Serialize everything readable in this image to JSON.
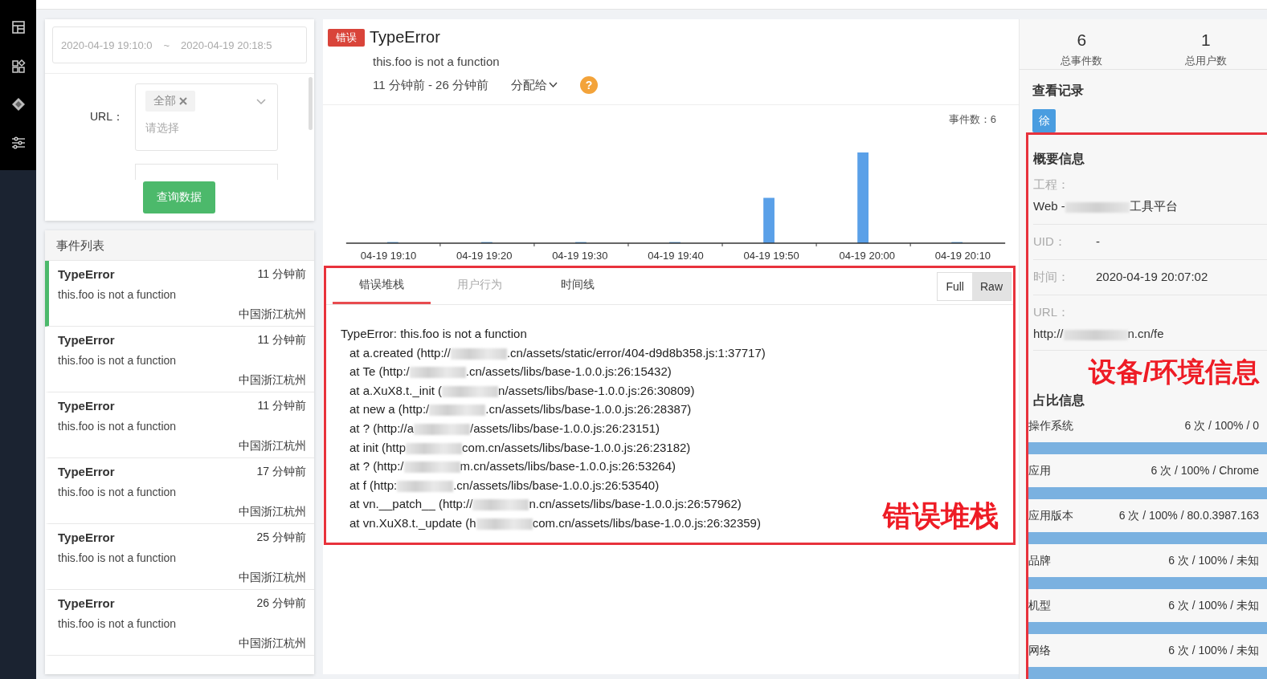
{
  "filter": {
    "date_start": "2020-04-19 19:10:0",
    "date_sep": "~",
    "date_end": "2020-04-19 20:18:5",
    "url_label": "URL：",
    "url_tag": "全部",
    "url_placeholder": "请选择",
    "query_button": "查询数据"
  },
  "event_list": {
    "title": "事件列表",
    "items": [
      {
        "name": "TypeError",
        "message": "this.foo is not a function",
        "time": "11 分钟前",
        "location": "中国浙江杭州",
        "selected": true
      },
      {
        "name": "TypeError",
        "message": "this.foo is not a function",
        "time": "11 分钟前",
        "location": "中国浙江杭州",
        "selected": false
      },
      {
        "name": "TypeError",
        "message": "this.foo is not a function",
        "time": "11 分钟前",
        "location": "中国浙江杭州",
        "selected": false
      },
      {
        "name": "TypeError",
        "message": "this.foo is not a function",
        "time": "17 分钟前",
        "location": "中国浙江杭州",
        "selected": false
      },
      {
        "name": "TypeError",
        "message": "this.foo is not a function",
        "time": "25 分钟前",
        "location": "中国浙江杭州",
        "selected": false
      },
      {
        "name": "TypeError",
        "message": "this.foo is not a function",
        "time": "26 分钟前",
        "location": "中国浙江杭州",
        "selected": false
      }
    ]
  },
  "issue": {
    "badge": "错误",
    "title": "TypeError",
    "message": "this.foo is not a function",
    "range": "11 分钟前 - 26 分钟前",
    "assign": "分配给",
    "help": "?"
  },
  "chart": {
    "count_label": "事件数：6",
    "x_labels": [
      "04-19 19:10",
      "04-19 19:20",
      "04-19 19:30",
      "04-19 19:40",
      "04-19 19:50",
      "04-19 20:00",
      "04-19 20:10"
    ]
  },
  "tabs": [
    {
      "label": "错误堆栈",
      "selected": true,
      "disabled": false
    },
    {
      "label": "用户行为",
      "selected": false,
      "disabled": true
    },
    {
      "label": "时间线",
      "selected": false,
      "disabled": false
    }
  ],
  "view_toggle": [
    {
      "label": "Full",
      "selected": false
    },
    {
      "label": "Raw",
      "selected": true
    }
  ],
  "stack": {
    "first_line": "TypeError: this.foo is not a function",
    "frames": [
      {
        "before": "at a.created (http://",
        "after": ".cn/assets/static/error/404-d9d8b358.js:1:37717)"
      },
      {
        "before": "at Te (http:/",
        "after": ".cn/assets/libs/base-1.0.0.js:26:15432)"
      },
      {
        "before": "at a.XuX8.t._init (",
        "after": "n/assets/libs/base-1.0.0.js:26:30809)"
      },
      {
        "before": "at new a (http:/",
        "after": ".cn/assets/libs/base-1.0.0.js:26:28387)"
      },
      {
        "before": "at ? (http://a",
        "after": "/assets/libs/base-1.0.0.js:26:23151)"
      },
      {
        "before": "at init (http",
        "after": "com.cn/assets/libs/base-1.0.0.js:26:23182)"
      },
      {
        "before": "at ? (http:/",
        "after": "m.cn/assets/libs/base-1.0.0.js:26:53264)"
      },
      {
        "before": "at f (http:",
        "after": ".cn/assets/libs/base-1.0.0.js:26:53540)"
      },
      {
        "before": "at vn.__patch__ (http://",
        "after": "n.cn/assets/libs/base-1.0.0.js:26:57962)"
      },
      {
        "before": "at vn.XuX8.t._update (h",
        "after": "com.cn/assets/libs/base-1.0.0.js:26:32359)"
      }
    ]
  },
  "stats": [
    {
      "value": "6",
      "label": "总事件数"
    },
    {
      "value": "1",
      "label": "总用户数"
    }
  ],
  "viewers": {
    "title": "查看记录",
    "avatars": [
      "徐"
    ]
  },
  "summary": {
    "title": "概要信息",
    "fields": [
      {
        "kind": "stacked",
        "label": "工程：",
        "before": "Web -",
        "after": "工具平台"
      },
      {
        "kind": "inline",
        "label": "UID：",
        "value": "-"
      },
      {
        "kind": "inline",
        "label": "时间：",
        "value": "2020-04-19 20:07:02"
      },
      {
        "kind": "stacked",
        "label": "URL：",
        "before": "http://",
        "after": "n.cn/fe"
      }
    ]
  },
  "ratios": {
    "title": "占比信息",
    "items": [
      {
        "label": "操作系统",
        "reading": "6 次 / 100% / 0",
        "level": 1
      },
      {
        "label": "应用",
        "reading": "6 次 / 100% / Chrome",
        "level": 1
      },
      {
        "label": "应用版本",
        "reading": "6 次 / 100% / 80.0.3987.163",
        "level": 1
      },
      {
        "label": "品牌",
        "reading": "6 次 / 100% / 未知",
        "level": 1
      },
      {
        "label": "机型",
        "reading": "6 次 / 100% / 未知",
        "level": 1
      },
      {
        "label": "网络",
        "reading": "6 次 / 100% / 未知",
        "level": 1
      }
    ]
  },
  "annotations": [
    {
      "kind": "stack",
      "text": "错误堆栈"
    },
    {
      "kind": "env",
      "text": "设备/环境信息"
    }
  ]
}
